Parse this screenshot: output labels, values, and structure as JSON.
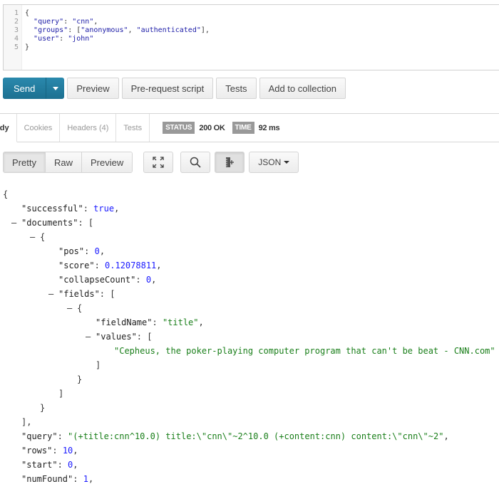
{
  "request_editor": {
    "line_numbers": [
      "1",
      "2",
      "3",
      "4",
      "5"
    ],
    "lines": [
      {
        "pre": "{",
        "parts": []
      },
      {
        "pre": "  ",
        "parts": [
          {
            "t": "\"query\"",
            "c": "k"
          },
          {
            "t": ": ",
            "c": ""
          },
          {
            "t": "\"cnn\"",
            "c": "s"
          },
          {
            "t": ",",
            "c": ""
          }
        ]
      },
      {
        "pre": "  ",
        "parts": [
          {
            "t": "\"groups\"",
            "c": "k"
          },
          {
            "t": ": [",
            "c": ""
          },
          {
            "t": "\"anonymous\"",
            "c": "s"
          },
          {
            "t": ", ",
            "c": ""
          },
          {
            "t": "\"authenticated\"",
            "c": "s"
          },
          {
            "t": "],",
            "c": ""
          }
        ]
      },
      {
        "pre": "  ",
        "parts": [
          {
            "t": "\"user\"",
            "c": "k"
          },
          {
            "t": ": ",
            "c": ""
          },
          {
            "t": "\"john\"",
            "c": "s"
          }
        ]
      },
      {
        "pre": "}",
        "parts": []
      }
    ]
  },
  "actions": {
    "send": "Send",
    "preview": "Preview",
    "pre_request": "Pre-request script",
    "tests": "Tests",
    "add_to_collection": "Add to collection"
  },
  "response_tabs": {
    "body": "ody",
    "cookies": "Cookies",
    "headers": "Headers (4)",
    "tests": "Tests",
    "status_label": "STATUS",
    "status_value": "200 OK",
    "time_label": "TIME",
    "time_value": "92 ms"
  },
  "view_bar": {
    "pretty": "Pretty",
    "raw": "Raw",
    "preview": "Preview",
    "format": "JSON"
  },
  "response_body": [
    {
      "indent": 0,
      "toggle": false,
      "parts": [
        {
          "t": "{",
          "c": ""
        }
      ]
    },
    {
      "indent": 1,
      "toggle": false,
      "parts": [
        {
          "t": "\"successful\"",
          "c": "key"
        },
        {
          "t": ": ",
          "c": ""
        },
        {
          "t": "true",
          "c": "bool"
        },
        {
          "t": ",",
          "c": ""
        }
      ]
    },
    {
      "indent": 1,
      "toggle": true,
      "parts": [
        {
          "t": "\"documents\"",
          "c": "key"
        },
        {
          "t": ": [",
          "c": ""
        }
      ]
    },
    {
      "indent": 2,
      "toggle": true,
      "parts": [
        {
          "t": "{",
          "c": ""
        }
      ]
    },
    {
      "indent": 3,
      "toggle": false,
      "parts": [
        {
          "t": "\"pos\"",
          "c": "key"
        },
        {
          "t": ": ",
          "c": ""
        },
        {
          "t": "0",
          "c": "num"
        },
        {
          "t": ",",
          "c": ""
        }
      ]
    },
    {
      "indent": 3,
      "toggle": false,
      "parts": [
        {
          "t": "\"score\"",
          "c": "key"
        },
        {
          "t": ": ",
          "c": ""
        },
        {
          "t": "0.12078811",
          "c": "num"
        },
        {
          "t": ",",
          "c": ""
        }
      ]
    },
    {
      "indent": 3,
      "toggle": false,
      "parts": [
        {
          "t": "\"collapseCount\"",
          "c": "key"
        },
        {
          "t": ": ",
          "c": ""
        },
        {
          "t": "0",
          "c": "num"
        },
        {
          "t": ",",
          "c": ""
        }
      ]
    },
    {
      "indent": 3,
      "toggle": true,
      "parts": [
        {
          "t": "\"fields\"",
          "c": "key"
        },
        {
          "t": ": [",
          "c": ""
        }
      ]
    },
    {
      "indent": 4,
      "toggle": true,
      "parts": [
        {
          "t": "{",
          "c": ""
        }
      ]
    },
    {
      "indent": 5,
      "toggle": false,
      "parts": [
        {
          "t": "\"fieldName\"",
          "c": "key"
        },
        {
          "t": ": ",
          "c": ""
        },
        {
          "t": "\"title\"",
          "c": "str"
        },
        {
          "t": ",",
          "c": ""
        }
      ]
    },
    {
      "indent": 5,
      "toggle": true,
      "parts": [
        {
          "t": "\"values\"",
          "c": "key"
        },
        {
          "t": ": [",
          "c": ""
        }
      ]
    },
    {
      "indent": 6,
      "toggle": false,
      "parts": [
        {
          "t": "\"Cepheus, the poker-playing computer program that can't be beat - CNN.com\"",
          "c": "str"
        }
      ]
    },
    {
      "indent": 5,
      "toggle": false,
      "parts": [
        {
          "t": "]",
          "c": ""
        }
      ]
    },
    {
      "indent": 4,
      "toggle": false,
      "parts": [
        {
          "t": "}",
          "c": ""
        }
      ]
    },
    {
      "indent": 3,
      "toggle": false,
      "parts": [
        {
          "t": "]",
          "c": ""
        }
      ]
    },
    {
      "indent": 2,
      "toggle": false,
      "parts": [
        {
          "t": "}",
          "c": ""
        }
      ]
    },
    {
      "indent": 1,
      "toggle": false,
      "parts": [
        {
          "t": "],",
          "c": ""
        }
      ]
    },
    {
      "indent": 1,
      "toggle": false,
      "parts": [
        {
          "t": "\"query\"",
          "c": "key"
        },
        {
          "t": ": ",
          "c": ""
        },
        {
          "t": "\"(+title:cnn^10.0) title:\\\"cnn\\\"~2^10.0 (+content:cnn) content:\\\"cnn\\\"~2\"",
          "c": "str"
        },
        {
          "t": ",",
          "c": ""
        }
      ]
    },
    {
      "indent": 1,
      "toggle": false,
      "parts": [
        {
          "t": "\"rows\"",
          "c": "key"
        },
        {
          "t": ": ",
          "c": ""
        },
        {
          "t": "10",
          "c": "num"
        },
        {
          "t": ",",
          "c": ""
        }
      ]
    },
    {
      "indent": 1,
      "toggle": false,
      "parts": [
        {
          "t": "\"start\"",
          "c": "key"
        },
        {
          "t": ": ",
          "c": ""
        },
        {
          "t": "0",
          "c": "num"
        },
        {
          "t": ",",
          "c": ""
        }
      ]
    },
    {
      "indent": 1,
      "toggle": false,
      "parts": [
        {
          "t": "\"numFound\"",
          "c": "key"
        },
        {
          "t": ": ",
          "c": ""
        },
        {
          "t": "1",
          "c": "num"
        },
        {
          "t": ",",
          "c": ""
        }
      ]
    }
  ]
}
